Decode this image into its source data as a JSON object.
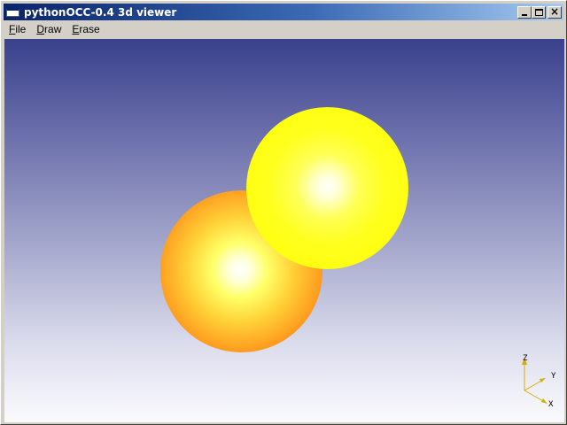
{
  "window": {
    "title": "pythonOCC-0.4 3d viewer"
  },
  "menu": {
    "items": [
      {
        "label": "File"
      },
      {
        "label": "Draw"
      },
      {
        "label": "Erase"
      }
    ]
  },
  "viewer": {
    "background_top_color": "#3a418c",
    "background_bottom_color": "#fbfbfd",
    "spheres": [
      {
        "name": "orange-sphere",
        "rim_color": "#f4500c",
        "highlight_color": "#ffffff"
      },
      {
        "name": "yellow-sphere",
        "rim_color": "#ffff00",
        "highlight_color": "#ffffff"
      }
    ],
    "triedron": {
      "color": "#d4b000",
      "axes": {
        "z": "Z",
        "y": "Y",
        "x": "X"
      }
    }
  },
  "icons": {
    "app": "app-window-icon",
    "minimize": "minimize-icon",
    "maximize": "maximize-icon",
    "close": "close-icon"
  }
}
